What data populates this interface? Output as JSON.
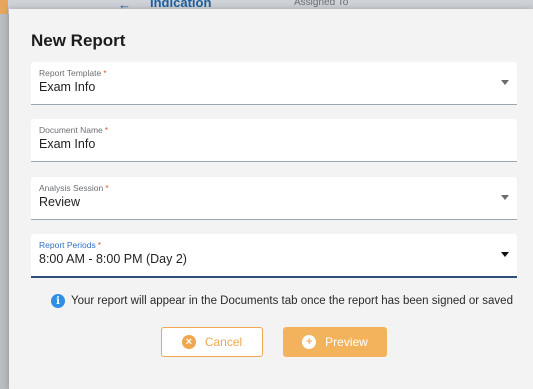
{
  "backdrop": {
    "heading": "Indication",
    "column": "Assigned To",
    "arrow": "←"
  },
  "dialog": {
    "title": "New Report",
    "required_mark": "*",
    "fields": [
      {
        "label": "Report Template",
        "value": "Exam Info"
      },
      {
        "label": "Document Name",
        "value": "Exam Info"
      },
      {
        "label": "Analysis Session",
        "value": "Review"
      },
      {
        "label": "Report Periods",
        "value": "8:00 AM - 8:00 PM (Day 2)"
      }
    ],
    "info_icon": "i",
    "info_text": "Your report will appear in the Documents tab once the report has been signed or saved",
    "cancel_label": "Cancel",
    "preview_label": "Preview",
    "cancel_icon": "×",
    "preview_icon": "+"
  },
  "colors": {
    "accent": "#f0a750",
    "info": "#2f8ee5",
    "required": "#e25d2b",
    "active_label": "#2e6fc6"
  },
  "icons": {
    "dropdown": "caret-down-icon",
    "info": "info-icon",
    "cancel": "close-circle-icon",
    "preview": "plus-circle-icon"
  }
}
